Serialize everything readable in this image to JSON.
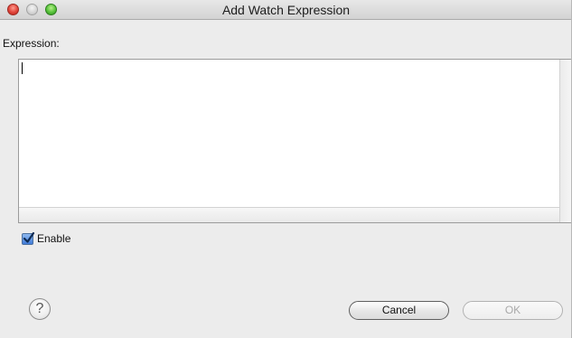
{
  "window": {
    "title": "Add Watch Expression",
    "controls": {
      "close": "close-icon",
      "minimize": "minimize-icon",
      "zoom": "zoom-icon"
    }
  },
  "form": {
    "expression_label": "Expression:",
    "expression_value": "",
    "enable_label": "Enable",
    "enable_checked": true
  },
  "footer": {
    "help_icon": "help-icon",
    "help_glyph": "?",
    "cancel_label": "Cancel",
    "ok_label": "OK",
    "ok_enabled": false
  },
  "colors": {
    "window_bg": "#ececec",
    "close": "#e0443a",
    "zoom": "#56c23a",
    "checkbox": "#3f7ad8"
  }
}
